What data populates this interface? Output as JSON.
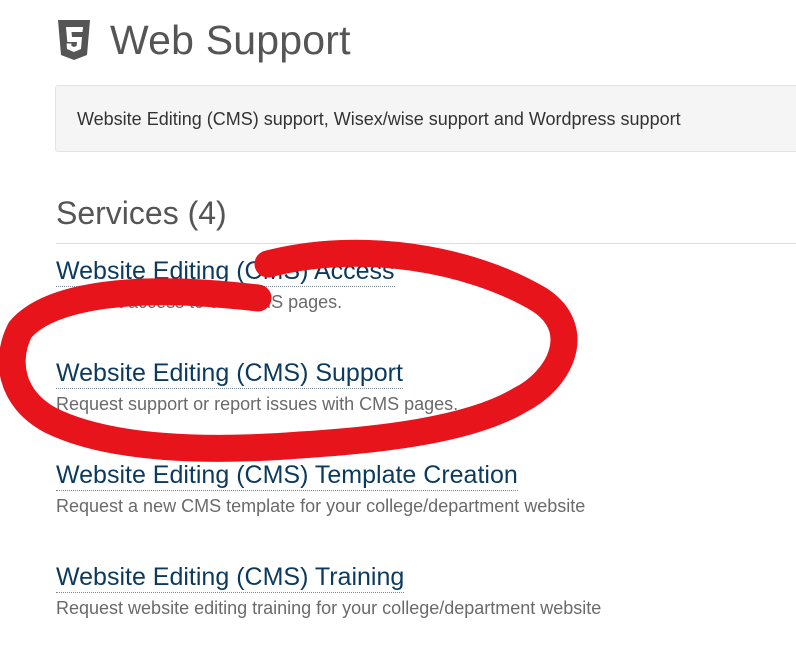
{
  "header": {
    "icon": "html5-icon",
    "title": "Web Support"
  },
  "description": {
    "text": "Website Editing (CMS) support, Wisex/wise support and Wordpress support"
  },
  "services": {
    "heading": "Services (4)",
    "items": [
      {
        "title": "Website Editing (CMS) Access",
        "description": "Request access to edit CMS pages."
      },
      {
        "title": "Website Editing (CMS) Support",
        "description": "Request support or report issues with CMS pages."
      },
      {
        "title": "Website Editing (CMS) Template Creation",
        "description": "Request a new CMS template for your college/department website"
      },
      {
        "title": "Website Editing (CMS) Training",
        "description": "Request website editing training for your college/department website"
      }
    ]
  },
  "colors": {
    "link": "#0b3a5e",
    "annotation": "#e8141c"
  }
}
